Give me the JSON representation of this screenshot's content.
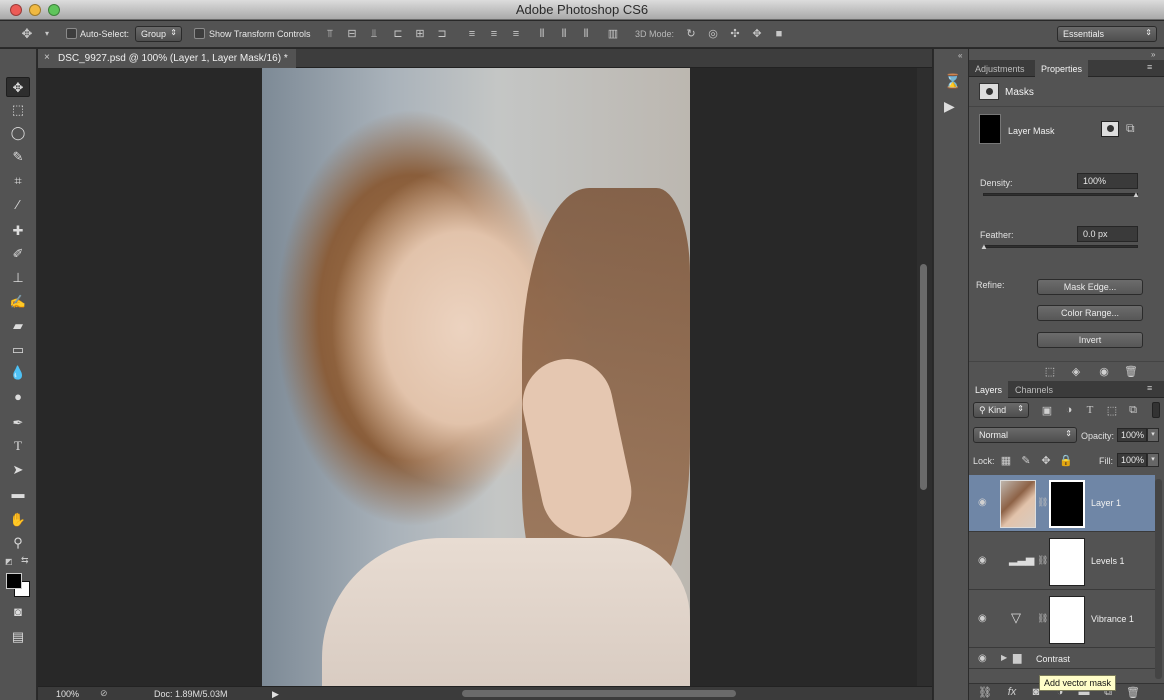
{
  "window": {
    "title": "Adobe Photoshop CS6"
  },
  "options_bar": {
    "auto_select_label": "Auto-Select:",
    "auto_select_value": "Group",
    "show_transform_label": "Show Transform Controls",
    "mode_3d_label": "3D Mode:",
    "workspace_value": "Essentials"
  },
  "document": {
    "tab_title": "DSC_9927.psd @ 100% (Layer 1, Layer Mask/16) *"
  },
  "status_bar": {
    "zoom": "100%",
    "doc_info": "Doc: 1.89M/5.03M"
  },
  "properties_panel": {
    "tabs": [
      "Adjustments",
      "Properties"
    ],
    "section_title": "Masks",
    "mask_label": "Layer Mask",
    "density_label": "Density:",
    "density_value": "100%",
    "feather_label": "Feather:",
    "feather_value": "0.0 px",
    "refine_label": "Refine:",
    "buttons": [
      "Mask Edge...",
      "Color Range...",
      "Invert"
    ]
  },
  "layers_panel": {
    "tabs": [
      "Layers",
      "Channels"
    ],
    "kind_value": "Kind",
    "blend_mode": "Normal",
    "opacity_label": "Opacity:",
    "opacity_value": "100%",
    "lock_label": "Lock:",
    "fill_label": "Fill:",
    "fill_value": "100%",
    "layers": [
      {
        "name": "Layer 1",
        "selected": true
      },
      {
        "name": "Levels 1",
        "selected": false
      },
      {
        "name": "Vibrance 1",
        "selected": false
      },
      {
        "name": "Contrast",
        "selected": false
      }
    ],
    "tooltip": "Add vector mask"
  },
  "colors": {
    "selection_row": "#6f86a6",
    "panel_bg": "#535353",
    "canvas_bg": "#282828"
  }
}
